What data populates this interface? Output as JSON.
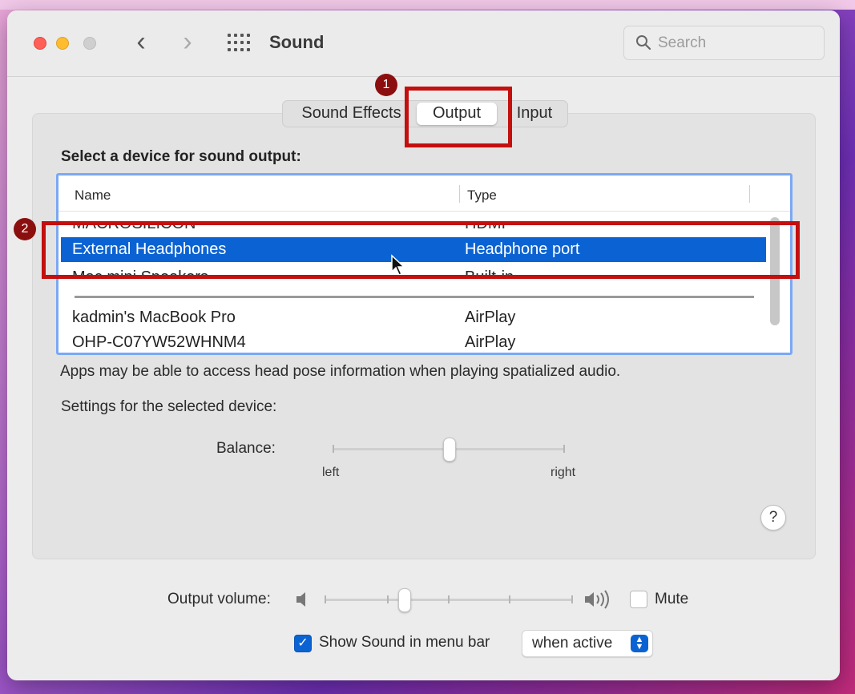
{
  "window": {
    "title": "Sound"
  },
  "search": {
    "placeholder": "Search"
  },
  "tabs": [
    {
      "label": "Sound Effects"
    },
    {
      "label": "Output"
    },
    {
      "label": "Input"
    }
  ],
  "annotations": {
    "badge1": "1",
    "badge2": "2",
    "accent": "#c40f0f"
  },
  "output": {
    "heading": "Select a device for sound output:",
    "columns": {
      "name": "Name",
      "type": "Type"
    },
    "devices": [
      {
        "name": "MACROSILICON",
        "type": "HDMI"
      },
      {
        "name": "External Headphones",
        "type": "Headphone port",
        "selected": true
      },
      {
        "name": "Mac mini Speakers",
        "type": "Built-in"
      },
      {
        "name": "kadmin's MacBook Pro",
        "type": "AirPlay"
      },
      {
        "name": "OHP-C07YW52WHNM4",
        "type": "AirPlay"
      }
    ],
    "note": "Apps may be able to access head pose information when playing spatialized audio.",
    "settings_label": "Settings for the selected device:",
    "balance": {
      "label": "Balance:",
      "left": "left",
      "right": "right",
      "value": 0.5
    },
    "help": "?"
  },
  "footer": {
    "volume_label": "Output volume:",
    "volume_level": 0.32,
    "mute_label": "Mute",
    "mute_checked": false,
    "show_label": "Show Sound in menu bar",
    "show_checked": true,
    "show_when": "when active"
  },
  "colors": {
    "selection": "#0b63d3",
    "list_focus": "#7aa8f5"
  }
}
